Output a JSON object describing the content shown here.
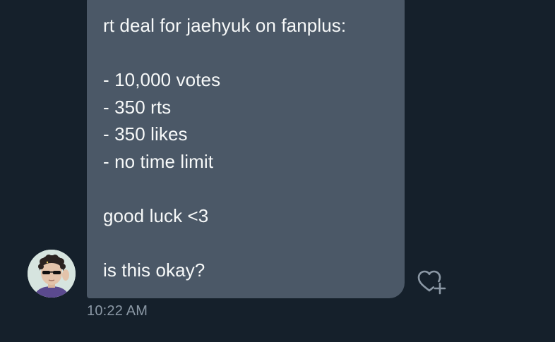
{
  "message": {
    "lines": [
      "rt deal for jaehyuk on fanplus:",
      "",
      "- 10,000 votes",
      "- 350 rts",
      "- 350 likes",
      "- no time limit",
      "",
      "good luck <3",
      "",
      "is this okay?"
    ],
    "timestamp": "10:22 AM"
  },
  "avatar": {
    "icon": "profile-photo"
  },
  "react_button": {
    "icon": "heart-plus-icon"
  },
  "colors": {
    "background": "#15202b",
    "bubble": "#4b5867",
    "text": "#f7f9f9",
    "muted": "#8b98a5"
  }
}
